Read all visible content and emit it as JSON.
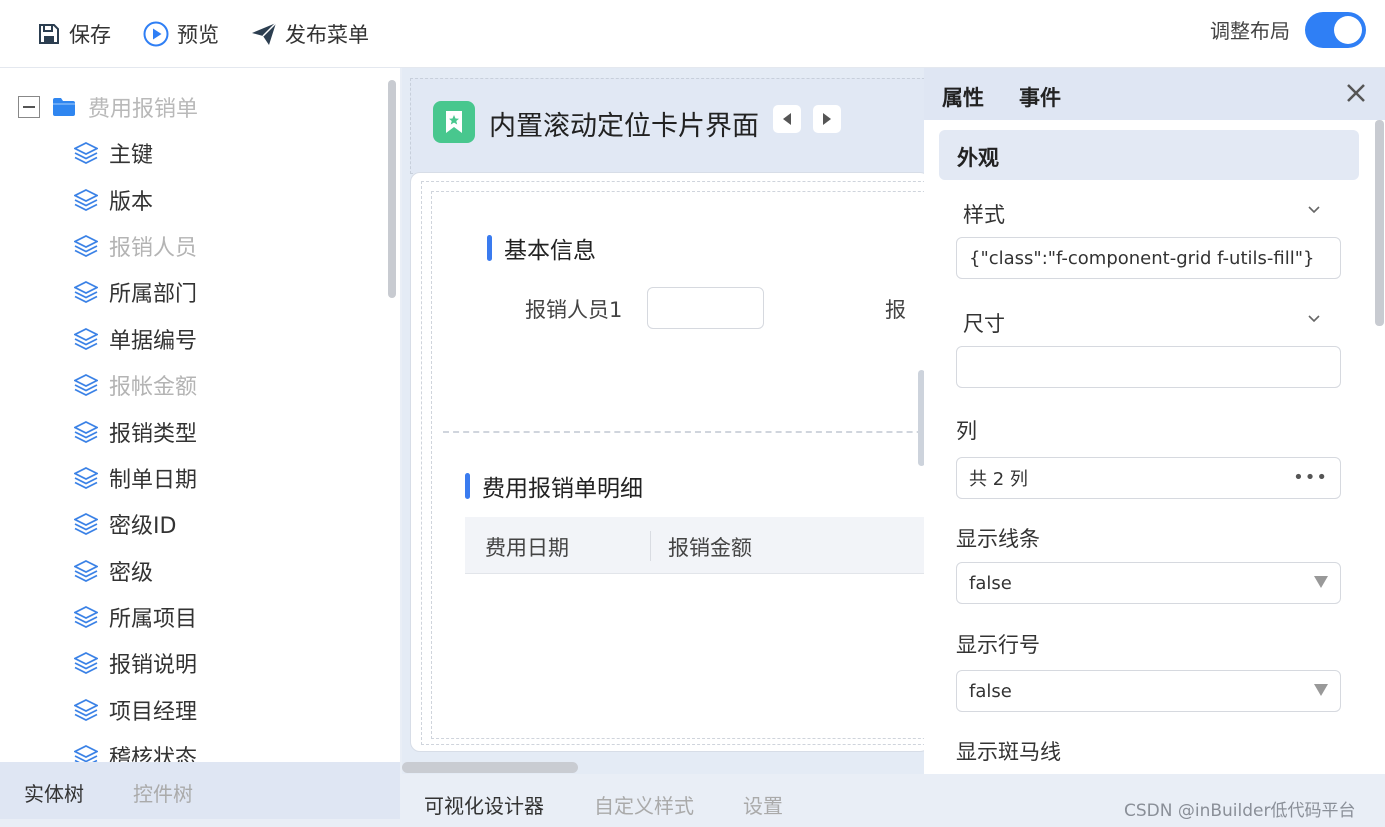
{
  "toolbar": {
    "save_label": "保存",
    "preview_label": "预览",
    "publish_label": "发布菜单",
    "adjust_layout_label": "调整布局",
    "adjust_layout_on": true
  },
  "entity_tree": {
    "root_label": "费用报销单",
    "items": [
      {
        "label": "主键",
        "muted": false
      },
      {
        "label": "版本",
        "muted": false
      },
      {
        "label": "报销人员",
        "muted": true
      },
      {
        "label": "所属部门",
        "muted": false
      },
      {
        "label": "单据编号",
        "muted": false
      },
      {
        "label": "报帐金额",
        "muted": true
      },
      {
        "label": "报销类型",
        "muted": false
      },
      {
        "label": "制单日期",
        "muted": false
      },
      {
        "label": "密级ID",
        "muted": false
      },
      {
        "label": "密级",
        "muted": false
      },
      {
        "label": "所属项目",
        "muted": false
      },
      {
        "label": "报销说明",
        "muted": false
      },
      {
        "label": "项目经理",
        "muted": false
      },
      {
        "label": "稽核状态",
        "muted": false
      }
    ]
  },
  "left_tabs": {
    "entity_tree": "实体树",
    "control_tree": "控件树"
  },
  "designer": {
    "page_title": "内置滚动定位卡片界面",
    "section_basic": "基本信息",
    "field_label": "报销人员1",
    "field_label_cut": "报",
    "section_detail": "费用报销单明细",
    "grid_columns": [
      "费用日期",
      "报销金额"
    ]
  },
  "bottom_tabs": {
    "visual_designer": "可视化设计器",
    "custom_style": "自定义样式",
    "settings": "设置"
  },
  "watermark": "CSDN @inBuilder低代码平台",
  "properties": {
    "tab_attributes": "属性",
    "tab_events": "事件",
    "group_appearance": "外观",
    "style_label": "样式",
    "style_value": "{\"class\":\"f-component-grid f-utils-fill\"}",
    "size_label": "尺寸",
    "size_value": "",
    "columns_label": "列",
    "columns_value": "共 2 列",
    "columns_more": "•••",
    "show_lines_label": "显示线条",
    "show_lines_value": "false",
    "show_row_number_label": "显示行号",
    "show_row_number_value": "false",
    "show_zebra_label": "显示斑马线"
  },
  "colors": {
    "accent": "#2f7ff5",
    "folder": "#2f86f0",
    "layer_icon": "#3b82e6",
    "header_icon": "#48c78e"
  }
}
